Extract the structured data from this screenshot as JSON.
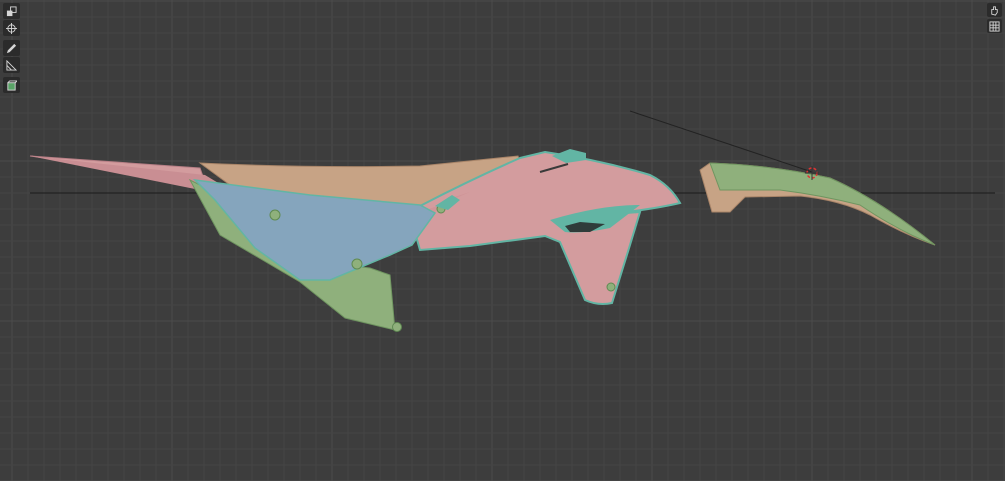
{
  "app": "3D viewport",
  "colors": {
    "background": "#3d3d3d",
    "grid_minor": "#454545",
    "grid_major": "#4b4b4b",
    "pink_part": "#d39c9e",
    "blue_part": "#85a5bd",
    "green_part": "#8fb07c",
    "tan_part": "#c7a385",
    "teal_edge": "#62b5a4",
    "icon": "#d6d6d6"
  },
  "toolbar": {
    "tools": [
      {
        "name": "transform-icon",
        "active": false
      },
      {
        "name": "cursor-crosshair-icon",
        "active": false
      },
      {
        "name": "annotate-icon",
        "active": false
      },
      {
        "name": "measure-icon",
        "active": false
      },
      {
        "name": "add-cube-icon",
        "active": true
      }
    ]
  },
  "navigation": {
    "buttons": [
      {
        "name": "hand-pan-icon"
      },
      {
        "name": "grid-perspective-icon"
      }
    ]
  },
  "scene": {
    "objects": [
      "motorcycle-fairing-body",
      "motorcycle-front-fender"
    ],
    "cursor": "3d-cursor"
  }
}
